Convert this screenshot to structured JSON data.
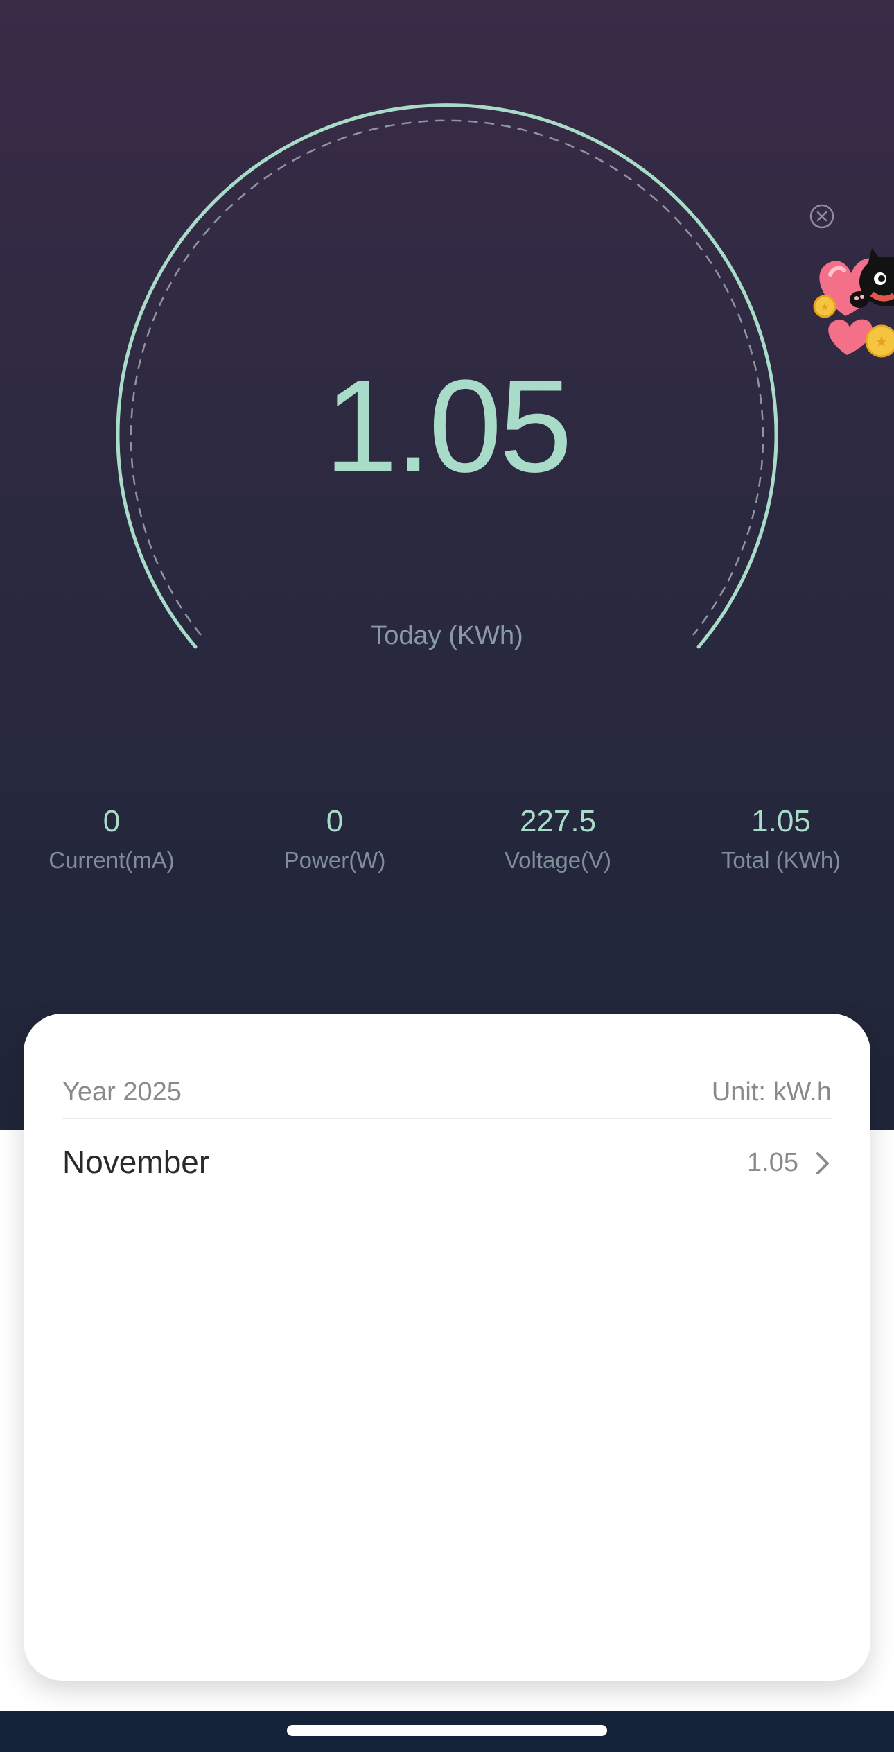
{
  "gauge": {
    "value": "1.05",
    "label": "Today (KWh)",
    "accent_color": "#a8dcc8"
  },
  "stats": [
    {
      "value": "0",
      "label": "Current(mA)"
    },
    {
      "value": "0",
      "label": "Power(W)"
    },
    {
      "value": "227.5",
      "label": "Voltage(V)"
    },
    {
      "value": "1.05",
      "label": "Total (KWh)"
    }
  ],
  "card": {
    "year": "Year 2025",
    "unit": "Unit: kW.h",
    "months": [
      {
        "name": "November",
        "value": "1.05"
      }
    ]
  },
  "promo": {
    "close_icon": "close-circle-icon",
    "image": "cat-hearts-coins-mascot"
  }
}
